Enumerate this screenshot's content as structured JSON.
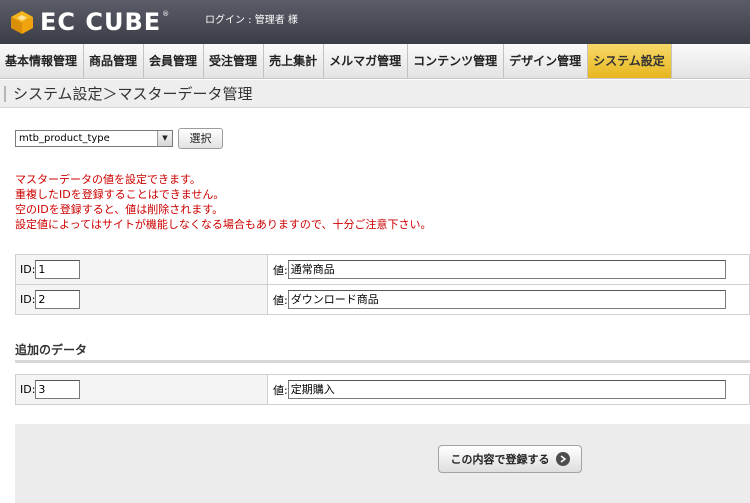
{
  "header": {
    "logo_text": "EC CUBE",
    "logo_reg": "®",
    "login_text": "ログイン : 管理者 様"
  },
  "nav": {
    "items": [
      {
        "label": "基本情報管理"
      },
      {
        "label": "商品管理"
      },
      {
        "label": "会員管理"
      },
      {
        "label": "受注管理"
      },
      {
        "label": "売上集計"
      },
      {
        "label": "メルマガ管理"
      },
      {
        "label": "コンテンツ管理"
      },
      {
        "label": "デザイン管理"
      },
      {
        "label": "システム設定",
        "active": true
      }
    ]
  },
  "page": {
    "title": "システム設定＞マスターデータ管理"
  },
  "selector": {
    "selected_value": "mtb_product_type",
    "button_label": "選択"
  },
  "notice": {
    "lines": [
      "マスターデータの値を設定できます。",
      "重複したIDを登録することはできません。",
      "空のIDを登録すると、値は削除されます。",
      "設定値によってはサイトが機能しなくなる場合もありますので、十分ご注意下さい。"
    ]
  },
  "labels": {
    "id": "ID:",
    "value": "値:"
  },
  "rows": [
    {
      "id": "1",
      "value": "通常商品"
    },
    {
      "id": "2",
      "value": "ダウンロード商品"
    }
  ],
  "add_section": {
    "heading": "追加のデータ",
    "row": {
      "id": "3",
      "value": "定期購入"
    }
  },
  "footer": {
    "register_label": "この内容で登録する"
  },
  "colors": {
    "notice": "#cc0000",
    "active_tab": "#e7b61e",
    "header_bg": "#3b3d46"
  }
}
